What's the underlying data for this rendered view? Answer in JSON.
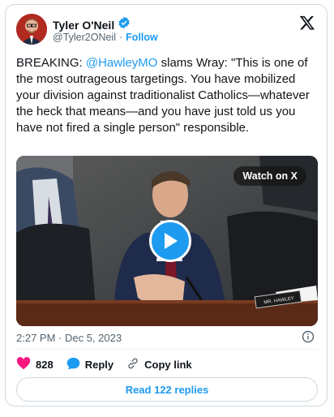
{
  "author": {
    "name": "Tyler O'Neil",
    "handle": "@Tyler2ONeil",
    "separator": "·",
    "follow_label": "Follow"
  },
  "tweet": {
    "prefix": "BREAKING: ",
    "mention": "@HawleyMO",
    "body": " slams Wray: \"This is one of the most outrageous targetings. You have mobilized your division against traditionalist Catholics—whatever the heck that means—and you have just told us you have not fired a single person\" responsible."
  },
  "video": {
    "watch_label": "Watch on X",
    "nameplate": "MR. HAWLEY"
  },
  "meta": {
    "timestamp": "2:27 PM · Dec 5, 2023"
  },
  "actions": {
    "like_count": "828",
    "reply_label": "Reply",
    "copy_label": "Copy link",
    "read_replies_label": "Read 122 replies"
  },
  "colors": {
    "accent": "#1d9bf0",
    "like": "#f91880",
    "text": "#0f1419",
    "muted": "#536471"
  }
}
